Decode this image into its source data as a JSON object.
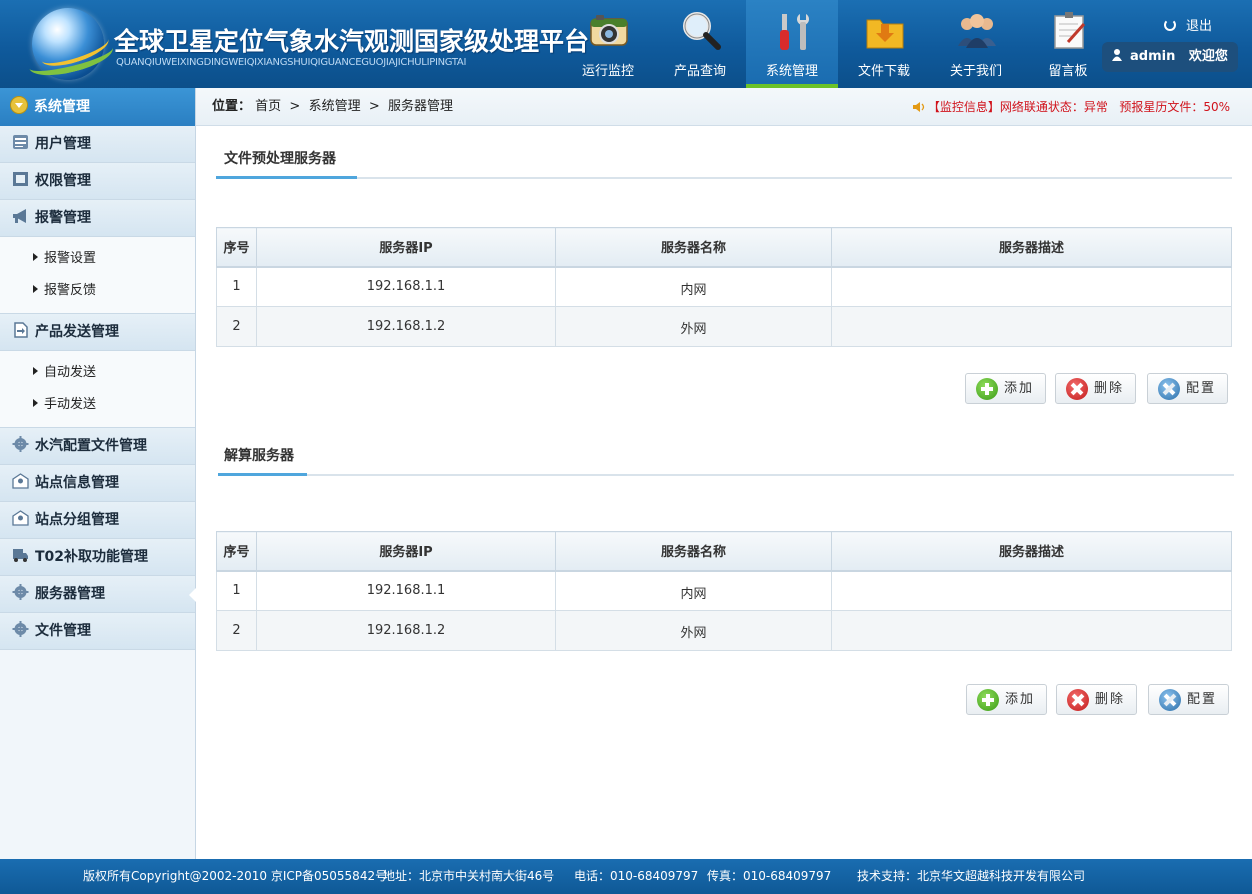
{
  "header": {
    "title": "全球卫星定位气象水汽观测国家级处理平台",
    "subtitle": "QUANQIUWEIXINGDINGWEIQIXIANGSHUIQIGUANCEGUOJIAJICHULIPINGTAI",
    "nav": [
      {
        "label": "运行监控",
        "icon": "camera-icon"
      },
      {
        "label": "产品查询",
        "icon": "magnifier-icon"
      },
      {
        "label": "系统管理",
        "icon": "tools-icon",
        "active": true
      },
      {
        "label": "文件下载",
        "icon": "folder-download-icon"
      },
      {
        "label": "关于我们",
        "icon": "people-icon"
      },
      {
        "label": "留言板",
        "icon": "note-icon"
      }
    ],
    "logout": "退出",
    "user": "admin",
    "welcome": "欢迎您",
    "accent": "#6cc229"
  },
  "sidebar": {
    "top": "系统管理",
    "items": [
      {
        "label": "用户管理"
      },
      {
        "label": "权限管理"
      },
      {
        "label": "报警管理",
        "subs": [
          "报警设置",
          "报警反馈"
        ]
      },
      {
        "label": "产品发送管理",
        "subs": [
          "自动发送",
          "手动发送"
        ]
      },
      {
        "label": "水汽配置文件管理"
      },
      {
        "label": "站点信息管理"
      },
      {
        "label": "站点分组管理"
      },
      {
        "label": "T02补取功能管理"
      },
      {
        "label": "服务器管理"
      },
      {
        "label": "文件管理"
      }
    ]
  },
  "breadcrumb": {
    "label": "位置：",
    "path": "首页  >  系统管理  >  服务器管理"
  },
  "monitor": {
    "text": "【监控信息】网络联通状态：异常   预报星历文件：50%",
    "color": "#d0121b"
  },
  "sections": [
    {
      "title": "文件预处理服务器",
      "columns": [
        "序号",
        "服务器IP",
        "服务器名称",
        "服务器描述"
      ],
      "rows": [
        [
          "1",
          "192.168.1.1",
          "内网",
          ""
        ],
        [
          "2",
          "192.168.1.2",
          "外网",
          ""
        ]
      ],
      "buttons": {
        "add": "添加",
        "delete": "删除",
        "config": "配置"
      }
    },
    {
      "title": "解算服务器",
      "columns": [
        "序号",
        "服务器IP",
        "服务器名称",
        "服务器描述"
      ],
      "rows": [
        [
          "1",
          "192.168.1.1",
          "内网",
          ""
        ],
        [
          "2",
          "192.168.1.2",
          "外网",
          ""
        ]
      ],
      "buttons": {
        "add": "添加",
        "delete": "删除",
        "config": "配置"
      }
    }
  ],
  "footer": {
    "copyright": "版权所有Copyright@2002-2010 京ICP备05055842号",
    "address": "地址：北京市中关村南大街46号",
    "phone": "电话：010-68409797",
    "fax": "传真：010-68409797",
    "support": "技术支持：北京华文超越科技开发有限公司"
  }
}
